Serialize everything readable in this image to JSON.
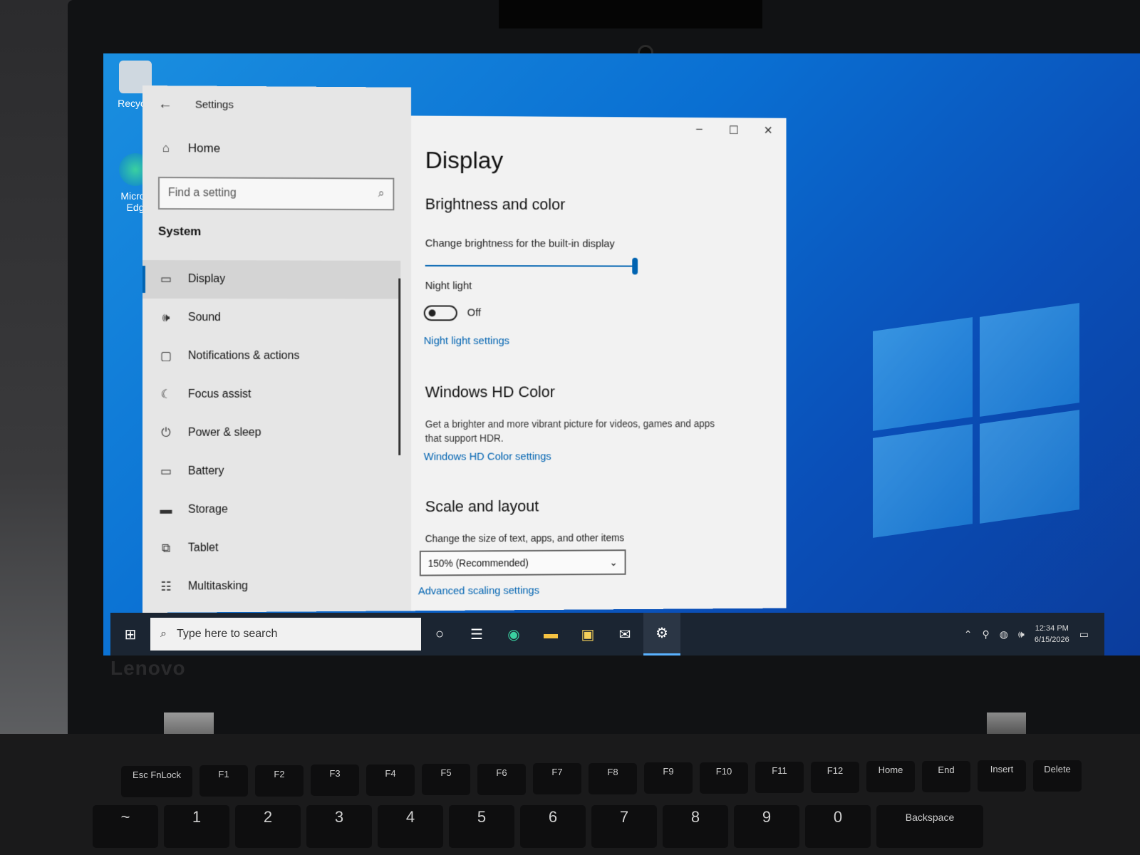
{
  "desktop": {
    "icons": [
      {
        "label": "Recycle"
      },
      {
        "label": "Micros Edg"
      }
    ]
  },
  "settings": {
    "title": "Settings",
    "home_label": "Home",
    "search_placeholder": "Find a setting",
    "section": "System",
    "nav": [
      {
        "label": "Display",
        "icon": "monitor-icon",
        "active": true
      },
      {
        "label": "Sound",
        "icon": "speaker-icon"
      },
      {
        "label": "Notifications & actions",
        "icon": "notification-icon"
      },
      {
        "label": "Focus assist",
        "icon": "moon-icon"
      },
      {
        "label": "Power & sleep",
        "icon": "power-icon"
      },
      {
        "label": "Battery",
        "icon": "battery-icon"
      },
      {
        "label": "Storage",
        "icon": "storage-icon"
      },
      {
        "label": "Tablet",
        "icon": "tablet-icon"
      },
      {
        "label": "Multitasking",
        "icon": "multitasking-icon"
      }
    ],
    "page": {
      "title": "Display",
      "brightness_heading": "Brightness and color",
      "brightness_label": "Change brightness for the built-in display",
      "brightness_value": 1.0,
      "night_light_label": "Night light",
      "night_light_state": "Off",
      "night_light_link": "Night light settings",
      "hd_heading": "Windows HD Color",
      "hd_desc_line1": "Get a brighter and more vibrant picture for videos, games and apps",
      "hd_desc_line2": "that support HDR.",
      "hd_link": "Windows HD Color settings",
      "scale_heading": "Scale and layout",
      "scale_label": "Change the size of text, apps, and other items",
      "scale_value": "150% (Recommended)",
      "scale_link": "Advanced scaling settings"
    }
  },
  "taskbar": {
    "search_placeholder": "Type here to search",
    "time": "12:34 PM",
    "date": "6/15/2026"
  },
  "laptop": {
    "brand": "Lenovo",
    "fn_keys": [
      "Esc FnLock",
      "F1",
      "F2",
      "F3",
      "F4",
      "F5",
      "F6",
      "F7",
      "F8",
      "F9",
      "F10",
      "F11",
      "F12",
      "Home",
      "End",
      "Insert",
      "Delete"
    ],
    "num_keys": [
      "~",
      "1",
      "2",
      "3",
      "4",
      "5",
      "6",
      "7",
      "8",
      "9",
      "0",
      "Backspace"
    ]
  },
  "colors": {
    "accent": "#0063b1",
    "desktop_blue": "#0a6fd2",
    "taskbar": "#1b2532"
  }
}
